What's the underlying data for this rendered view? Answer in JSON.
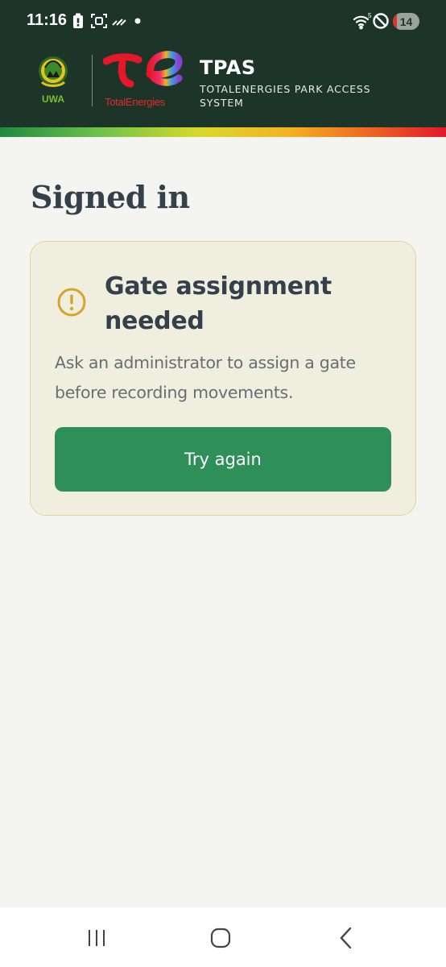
{
  "status_bar": {
    "time": "11:16",
    "battery_level": "14",
    "icons": [
      "battery-saver-icon",
      "screenshot-icon",
      "signal-boost-icon",
      "notification-dot-icon",
      "wifi-icon",
      "do-not-disturb-icon"
    ]
  },
  "header": {
    "uwa_logo_text": "UWA",
    "partner_logo_text": "TotalEnergies",
    "app_title": "TPAS",
    "app_subtitle": "TOTALENERGIES PARK ACCESS SYSTEM"
  },
  "main": {
    "page_title": "Signed in",
    "card": {
      "icon": "warning-circle-icon",
      "title": "Gate assignment needed",
      "body": "Ask an administrator to assign a gate before recording movements.",
      "button_label": "Try again"
    }
  },
  "nav_bar": {
    "items": [
      "recents-icon",
      "home-icon",
      "back-icon"
    ]
  },
  "colors": {
    "header_bg": "#1d3529",
    "page_bg": "#f4f5f1",
    "card_bg": "#f0efdf",
    "card_border": "#e3d49e",
    "warning": "#d4a628",
    "button_bg": "#2e8f59",
    "title_text": "#34404a"
  }
}
